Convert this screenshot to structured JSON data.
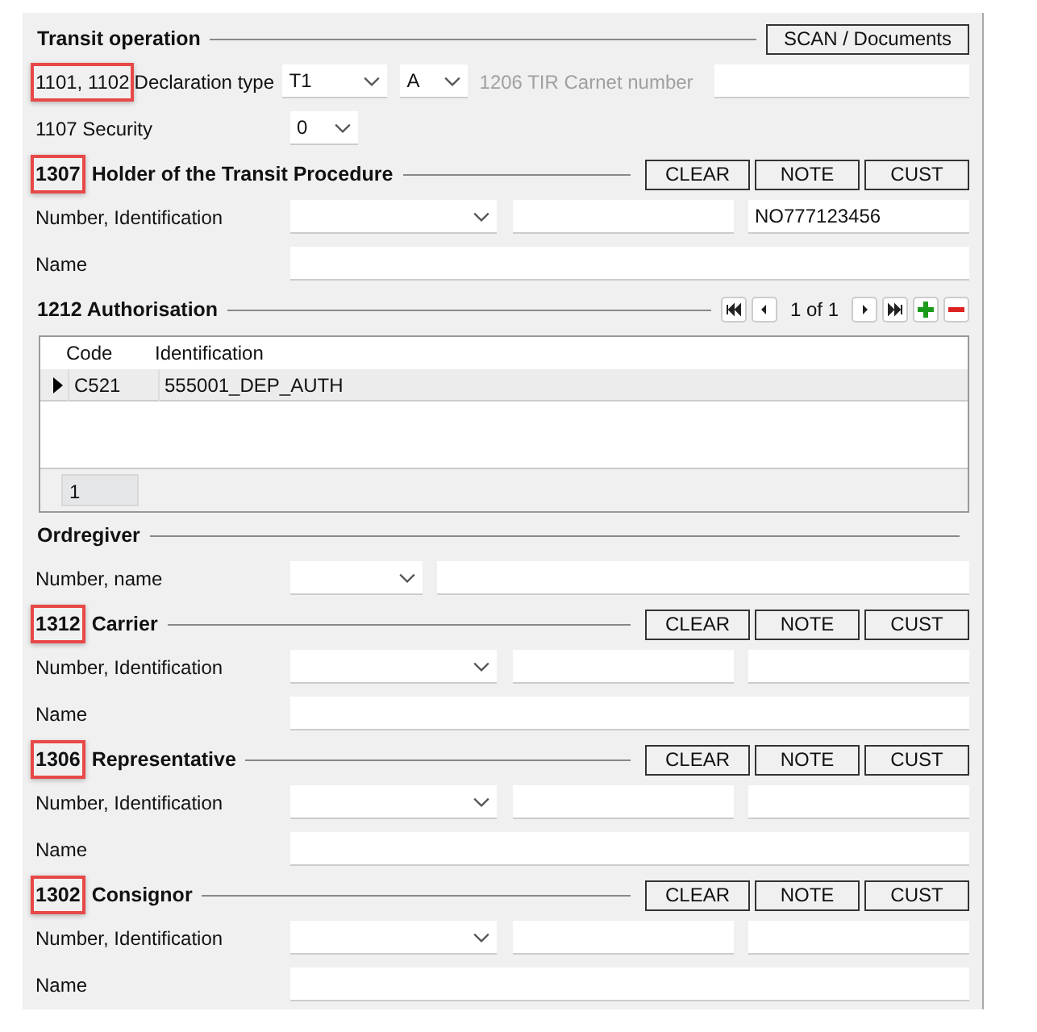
{
  "transit": {
    "title": "Transit operation",
    "scan_button": "SCAN / Documents",
    "declaration": {
      "code": "1101, 1102",
      "highlighted": true,
      "label": "Declaration type",
      "type": "T1",
      "subtype": "A",
      "tir_label": "1206 TIR Carnet number",
      "tir_disabled": true
    },
    "security": {
      "label": "1107 Security",
      "value": "0"
    }
  },
  "sections": [
    {
      "kind": "party",
      "code": "1307",
      "highlighted": true,
      "title": "Holder of the Transit Procedure",
      "buttons": [
        "CLEAR",
        "NOTE",
        "CUST"
      ],
      "id_label": "Number, Identification",
      "id_value": "NO777123456",
      "name_label": "Name"
    },
    {
      "kind": "authorisation",
      "title": "1212 Authorisation",
      "pager": "1 of 1",
      "columns": [
        "Code",
        "Identification"
      ],
      "rows": [
        {
          "cells": [
            "C521",
            "555001_DEP_AUTH"
          ],
          "selected": true
        }
      ],
      "footer": "1"
    },
    {
      "kind": "ordregiver",
      "title": "Ordregiver",
      "label": "Number, name"
    },
    {
      "kind": "party",
      "code": "1312",
      "highlighted": true,
      "title": "Carrier",
      "buttons": [
        "CLEAR",
        "NOTE",
        "CUST"
      ],
      "id_label": "Number, Identification",
      "name_label": "Name"
    },
    {
      "kind": "party",
      "code": "1306",
      "highlighted": true,
      "title": "Representative",
      "buttons": [
        "CLEAR",
        "NOTE",
        "CUST"
      ],
      "id_label": "Number, Identification",
      "name_label": "Name"
    },
    {
      "kind": "party",
      "code": "1302",
      "highlighted": true,
      "title": "Consignor",
      "buttons": [
        "CLEAR",
        "NOTE",
        "CUST"
      ],
      "id_label": "Number, Identification",
      "name_label": "Name"
    }
  ]
}
